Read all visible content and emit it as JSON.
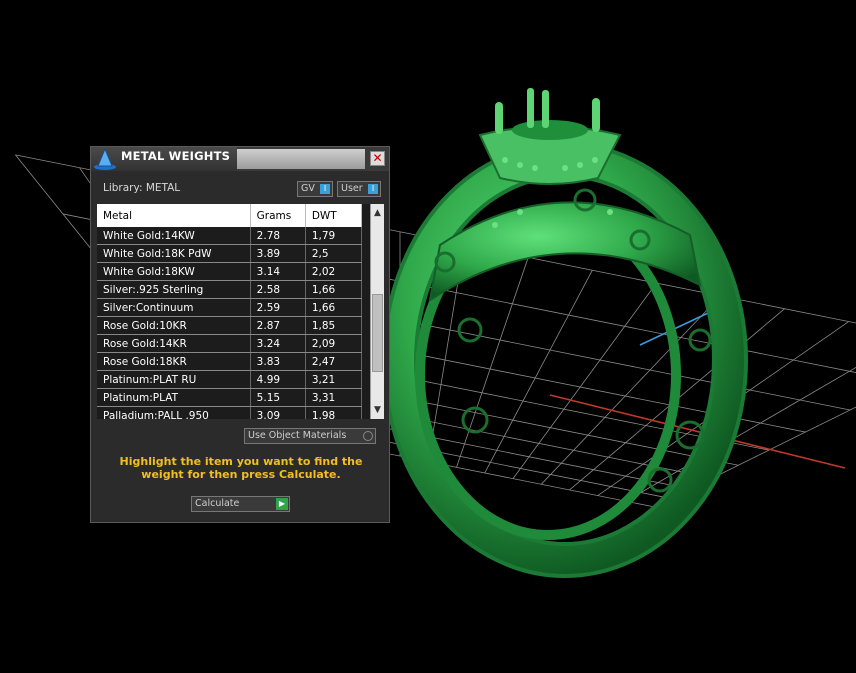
{
  "panel": {
    "title": "METAL WEIGHTS",
    "close_glyph": "✕",
    "library_label": "Library: METAL",
    "gv_toggle": "GV",
    "user_toggle": "User",
    "toggle_knob_glyph": "I",
    "columns": [
      "Metal",
      "Grams",
      "DWT"
    ],
    "rows": [
      [
        "White Gold:14KW",
        "2.78",
        "1,79"
      ],
      [
        "White Gold:18K PdW",
        "3.89",
        "2,5"
      ],
      [
        "White Gold:18KW",
        "3.14",
        "2,02"
      ],
      [
        "Silver:.925 Sterling",
        "2.58",
        "1,66"
      ],
      [
        "Silver:Continuum",
        "2.59",
        "1,66"
      ],
      [
        "Rose Gold:10KR",
        "2.87",
        "1,85"
      ],
      [
        "Rose Gold:14KR",
        "3.24",
        "2,09"
      ],
      [
        "Rose Gold:18KR",
        "3.83",
        "2,47"
      ],
      [
        "Platinum:PLAT RU",
        "4.99",
        "3,21"
      ],
      [
        "Platinum:PLAT",
        "5.15",
        "3,31"
      ],
      [
        "Palladium:PALL .950",
        "3.09",
        "1,98"
      ]
    ],
    "scroll_up_glyph": "▲",
    "scroll_down_glyph": "▼",
    "use_object_materials": "Use Object Materials",
    "instruction": "Highlight the item you want to find the weight for then press Calculate.",
    "calculate_label": "Calculate",
    "calculate_glyph": "▶"
  },
  "colors": {
    "ring_green": "#2fa84a",
    "instruction_yellow": "#f0c020",
    "grid": "#8a8a8a",
    "axis_x": "#c0392b",
    "axis_z": "#3a9ad9"
  },
  "icons": [
    "app-logo-icon",
    "close-icon",
    "chevron-up-icon",
    "chevron-down-icon",
    "play-icon"
  ]
}
